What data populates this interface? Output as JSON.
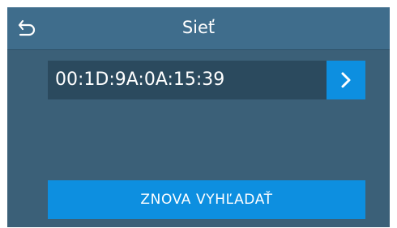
{
  "header": {
    "title": "Sieť",
    "back_icon": "back-arrow-icon"
  },
  "network": {
    "address": "00:1D:9A:0A:15:39",
    "open_icon": "chevron-right-icon"
  },
  "actions": {
    "rescan_label": "ZNOVA VYHĽADAŤ"
  },
  "colors": {
    "background": "#3b6078",
    "header": "#3f6d8c",
    "field": "#2b4a5e",
    "accent": "#0d8fe0"
  }
}
